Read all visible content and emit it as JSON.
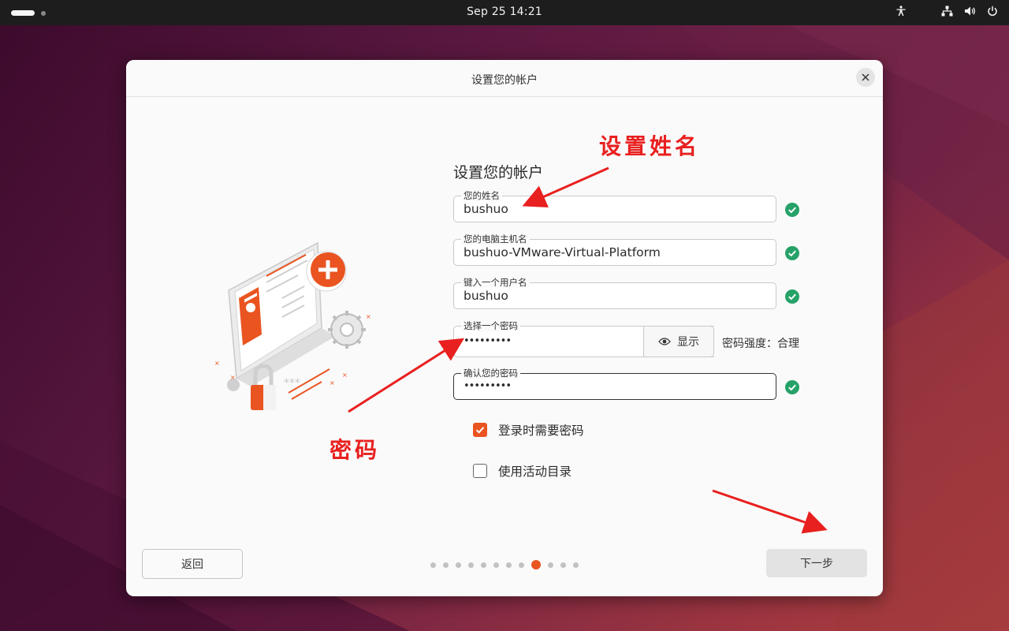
{
  "topbar": {
    "clock": "Sep 25  14:21"
  },
  "dialog": {
    "window_title": "设置您的帐户",
    "section_title": "设置您的帐户",
    "fields": {
      "name": {
        "label": "您的姓名",
        "value": "bushuo"
      },
      "hostname": {
        "label": "您的电脑主机名",
        "value": "bushuo-VMware-Virtual-Platform"
      },
      "username": {
        "label": "键入一个用户名",
        "value": "bushuo"
      },
      "password": {
        "label": "选择一个密码",
        "value": "•••••••••",
        "show_label": "显示",
        "strength": "密码强度：合理"
      },
      "confirm": {
        "label": "确认您的密码",
        "value": "•••••••••"
      }
    },
    "options": {
      "require_password": {
        "label": "登录时需要密码",
        "checked": true
      },
      "active_directory": {
        "label": "使用活动目录",
        "checked": false
      }
    },
    "back_label": "返回",
    "next_label": "下一步",
    "progress": {
      "total_steps": 12,
      "current_step": 9
    }
  },
  "annotations": {
    "name_note": "设置姓名",
    "password_note": "密码"
  },
  "colors": {
    "accent": "#e95420",
    "success": "#26a269",
    "annotation": "#e8201f",
    "topbar": "#1d1d1d"
  }
}
